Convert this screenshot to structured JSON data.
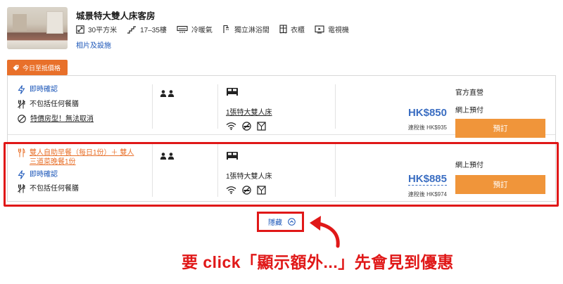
{
  "room": {
    "title": "城景特大雙人床客房",
    "amenities": [
      {
        "icon": "area-icon",
        "label": "30平方米"
      },
      {
        "icon": "floor-icon",
        "label": "17–35樓"
      },
      {
        "icon": "ac-icon",
        "label": "冷暖氣"
      },
      {
        "icon": "shower-icon",
        "label": "獨立淋浴間"
      },
      {
        "icon": "wardrobe-icon",
        "label": "衣櫃"
      },
      {
        "icon": "tv-icon",
        "label": "電視機"
      }
    ],
    "photos_link": "相片及設施"
  },
  "price_tag": "今日至抵價格",
  "offers": [
    {
      "features": [
        "即時確認",
        "不包括任何餐膳",
        "特價房型！無法取消"
      ],
      "bed": "1張特大雙人床",
      "price": "HK$850",
      "price_after_tax": "連稅後 HK$935",
      "pay_labels": [
        "官方直營",
        "網上預付"
      ],
      "book_label": "預訂"
    },
    {
      "features": [
        "雙人自助早餐（每日1份）＋ 雙人三道菜晚餐1份",
        "即時確認",
        "不包括任何餐膳"
      ],
      "bed": "1張特大雙人床",
      "price": "HK$885",
      "price_after_tax": "連稅後 HK$974",
      "pay_labels": [
        "網上預付"
      ],
      "book_label": "預訂"
    }
  ],
  "hide_label": "隱藏",
  "annotation": "要 click「顯示額外...」先會見到優惠",
  "colors": {
    "accent_orange": "#f0953a",
    "tag_orange": "#e8702a",
    "link_blue": "#1a55b8",
    "price_blue": "#3b6ec2",
    "highlight_red": "#e01818"
  }
}
